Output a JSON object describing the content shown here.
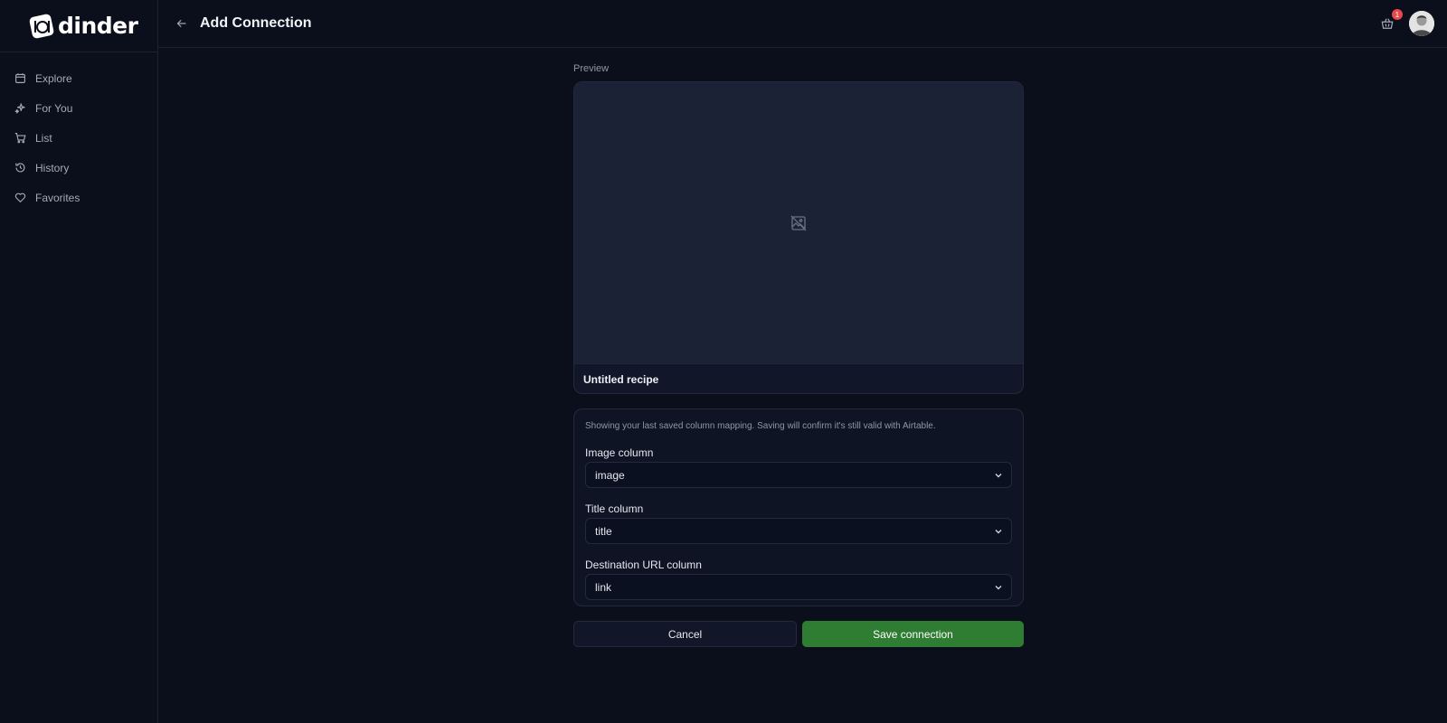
{
  "brand": {
    "name": "dinder"
  },
  "sidebar": {
    "items": [
      {
        "label": "Explore",
        "icon": "calendar-icon"
      },
      {
        "label": "For You",
        "icon": "sparkles-icon"
      },
      {
        "label": "List",
        "icon": "cart-icon"
      },
      {
        "label": "History",
        "icon": "history-icon"
      },
      {
        "label": "Favorites",
        "icon": "heart-icon"
      }
    ]
  },
  "header": {
    "title": "Add Connection",
    "basket_count": "1"
  },
  "preview": {
    "label": "Preview",
    "recipe_title": "Untitled recipe"
  },
  "mapping": {
    "note": "Showing your last saved column mapping. Saving will confirm it's still valid with Airtable.",
    "fields": [
      {
        "label": "Image column",
        "value": "image"
      },
      {
        "label": "Title column",
        "value": "title"
      },
      {
        "label": "Destination URL column",
        "value": "link"
      }
    ]
  },
  "actions": {
    "cancel_label": "Cancel",
    "save_label": "Save connection"
  },
  "colors": {
    "background": "#0b0f1c",
    "accent_save": "#2e7d32",
    "badge": "#e5484d"
  }
}
